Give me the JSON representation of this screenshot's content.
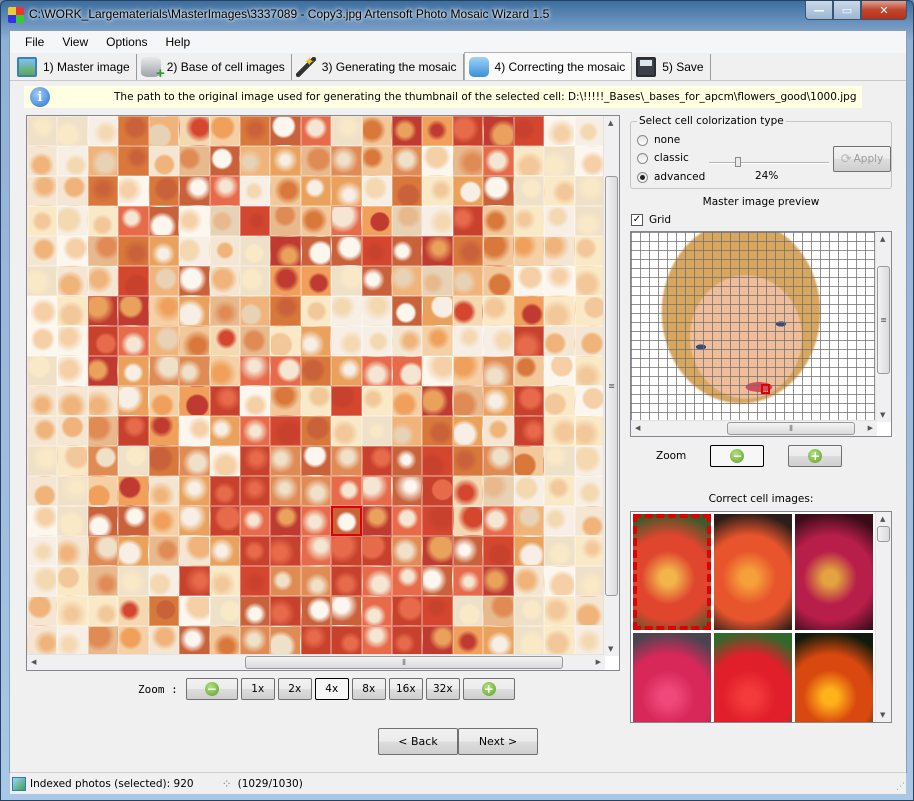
{
  "window": {
    "title": "C:\\WORK_Largematerials\\MasterImages\\3337089 - Copy3.jpg Artensoft Photo Mosaic Wizard 1.5",
    "controls": {
      "minimize": "—",
      "maximize": "▭",
      "close": "✕"
    }
  },
  "menu": {
    "items": [
      "File",
      "View",
      "Options",
      "Help"
    ]
  },
  "tabs": [
    {
      "label": "1) Master image",
      "icon": "picture-icon"
    },
    {
      "label": "2) Base of cell images",
      "icon": "database-add-icon"
    },
    {
      "label": "3) Generating the mosaic",
      "icon": "magic-wand-icon"
    },
    {
      "label": "4) Correcting the mosaic",
      "icon": "cube-icon",
      "active": true
    },
    {
      "label": "5) Save",
      "icon": "floppy-disk-icon"
    }
  ],
  "info": {
    "icon": "i",
    "text": "The path to the original image used for generating the thumbnail of the selected cell: D:\\!!!!!_Bases\\_bases_for_apcm\\flowers_good\\1000.jpg"
  },
  "mosaic": {
    "palette": [
      "#f4e6d2",
      "#f2c89a",
      "#e9a15c",
      "#f0b47a",
      "#d9783b",
      "#f7efe6",
      "#e8d2b6",
      "#c9613a",
      "#f3d8b0",
      "#e7b98c",
      "#fbf6ee",
      "#d5462f",
      "#e08a54",
      "#f5cfa5",
      "#c7412d",
      "#efe0c8",
      "#f0a05a",
      "#e76a4a",
      "#f9e9c7",
      "#bf3a30"
    ],
    "scroll": {
      "vertical_position": 0.5,
      "horizontal_position": 0.6
    },
    "selected_cell": {
      "row": 13,
      "col": 10
    }
  },
  "zoom_bar": {
    "label": "Zoom :",
    "levels": [
      "1x",
      "2x",
      "4x",
      "8x",
      "16x",
      "32x"
    ],
    "selected": "4x",
    "minus": "−",
    "plus": "+"
  },
  "colorization": {
    "legend": "Select cell colorization type",
    "options": [
      "none",
      "classic",
      "advanced"
    ],
    "selected": "advanced",
    "intensity_percent": 24,
    "intensity_label": "24%",
    "apply_label": "Apply",
    "apply_icon": "⟳"
  },
  "preview": {
    "title": "Master image preview",
    "grid_label": "Grid",
    "grid_checked": true,
    "check_mark": "✓",
    "zoom_label": "Zoom",
    "minus": "−",
    "plus": "+"
  },
  "correct_cells": {
    "title": "Correct cell images:",
    "images": [
      {
        "colors": [
          "#3d5a2a",
          "#e0452e",
          "#f2b54a"
        ],
        "selected": true
      },
      {
        "colors": [
          "#2b1d1a",
          "#e8552c",
          "#f5a13a"
        ]
      },
      {
        "colors": [
          "#3a0c1a",
          "#b81e4a",
          "#e2a340"
        ]
      },
      {
        "colors": [
          "#4a4450",
          "#d8285a",
          "#f0487a"
        ]
      },
      {
        "colors": [
          "#2f6a2a",
          "#e01f2a",
          "#f43a3a"
        ]
      },
      {
        "colors": [
          "#101a0c",
          "#d9480e",
          "#ffb21a"
        ]
      }
    ]
  },
  "nav": {
    "back_label": "< Back",
    "next_label": "Next >"
  },
  "status": {
    "indexed_label": "Indexed photos (selected): 920",
    "progress": "(1029/1030)",
    "spinner": "⁘",
    "grip": "⋰"
  }
}
